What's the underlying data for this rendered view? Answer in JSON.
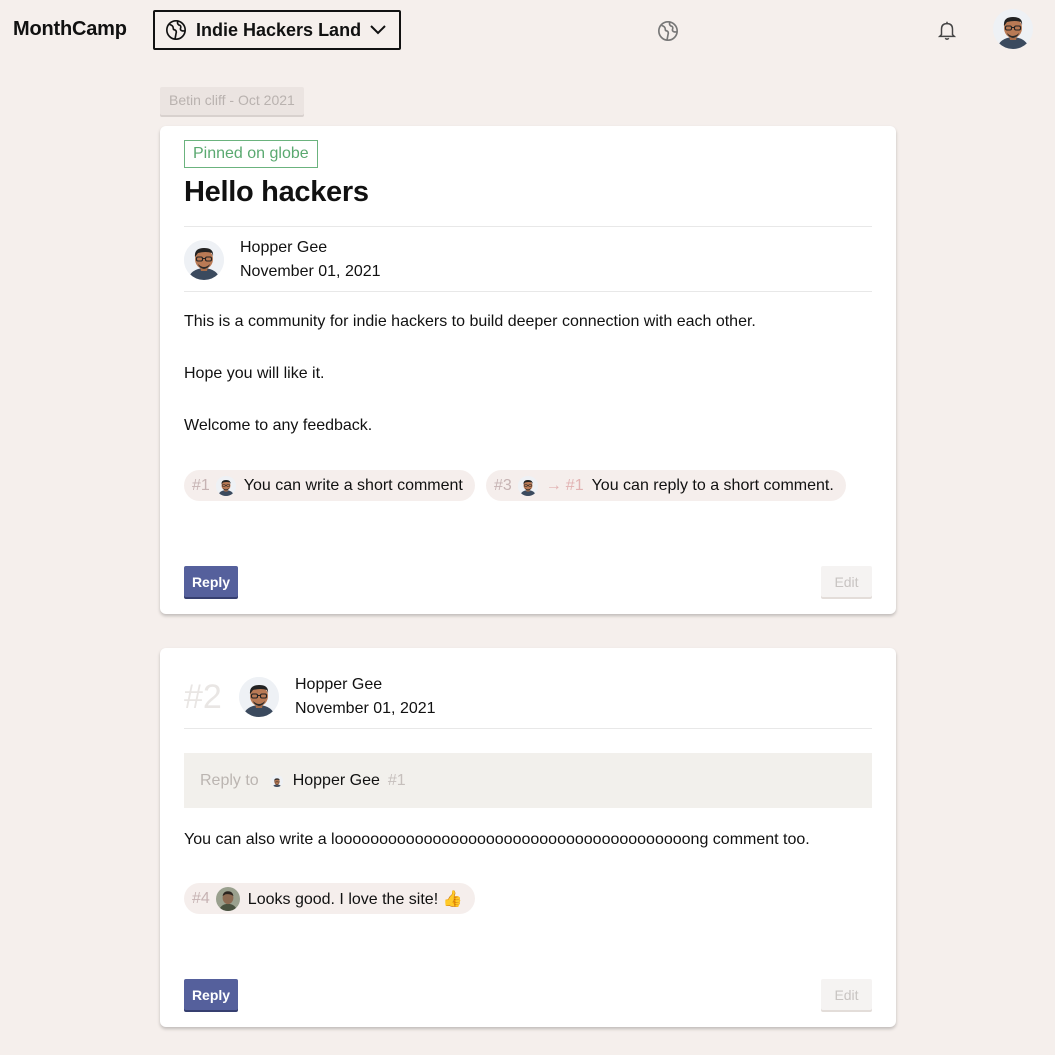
{
  "header": {
    "brand": "MonthCamp",
    "community": "Indie Hackers Land",
    "icons": [
      "globe-icon",
      "chevron-down-icon",
      "bell-icon",
      "avatar"
    ]
  },
  "post_author_tag": "Betin cliff - Oct 2021",
  "post": {
    "pinned_label": "Pinned on globe",
    "title": "Hello hackers",
    "author": "Hopper Gee",
    "date": "November 01, 2021",
    "paragraphs": [
      "This is a community for indie hackers to build deeper connection with each other.",
      "Hope you will like it.",
      "Welcome to any feedback."
    ],
    "short_comments": [
      {
        "num": "#1",
        "text": "You can write a short comment"
      },
      {
        "num": "#3",
        "reply_to": "#1",
        "text": "You can reply to a short comment."
      }
    ],
    "reply_label": "Reply",
    "edit_label": "Edit"
  },
  "comment": {
    "num": "#2",
    "author": "Hopper Gee",
    "date": "November 01, 2021",
    "reply_to_label": "Reply to",
    "reply_to_name": "Hopper Gee",
    "reply_to_num": "#1",
    "text": "You can also write a loooooooooooooooooooooooooooooooooooooooong comment too.",
    "short_comments": [
      {
        "num": "#4",
        "text": "Looks good. I love the site! 👍"
      }
    ],
    "reply_label": "Reply",
    "edit_label": "Edit"
  },
  "colors": {
    "background": "#f5efec",
    "pinned_green": "#5aa970",
    "reply_button": "#55609c"
  }
}
